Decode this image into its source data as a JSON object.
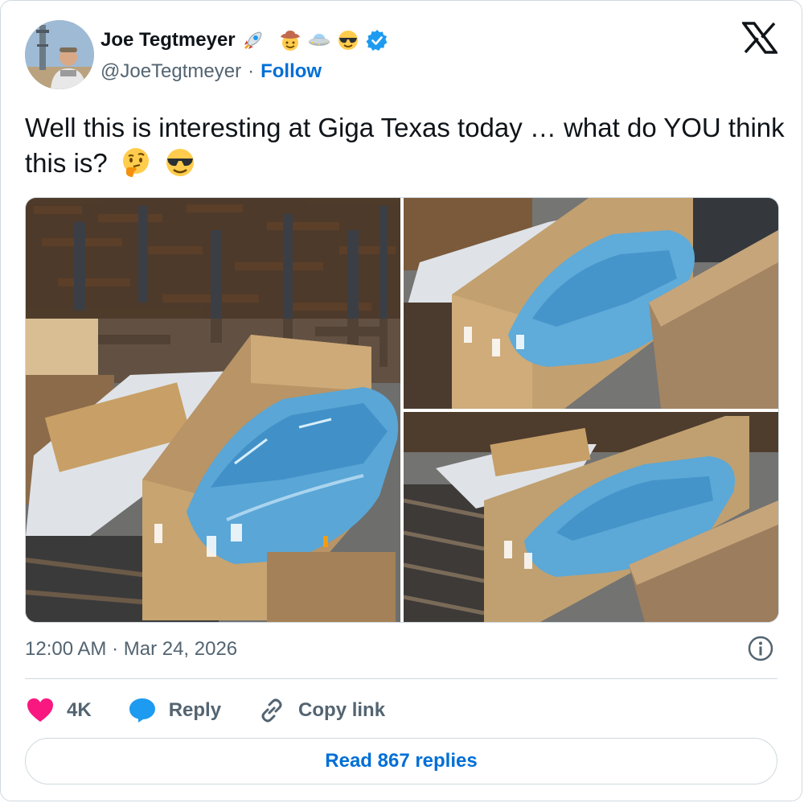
{
  "author": {
    "name": "Joe Tegtmeyer",
    "handle": "@JoeTegtmeyer",
    "separator": "·",
    "follow_label": "Follow",
    "name_emojis": [
      "rocket-emoji",
      "cowboy-emoji",
      "ufo-emoji",
      "sunglasses-emoji"
    ],
    "verified": true
  },
  "tweet": {
    "text": "Well this is interesting at Giga Texas today … what do YOU think this is?",
    "text_emojis": [
      "thinking-emoji",
      "sunglasses-emoji"
    ],
    "images": [
      {
        "name": "photo-main",
        "subject": "plastic-wrapped vehicle in open wooden crate"
      },
      {
        "name": "photo-top-right",
        "subject": "wrapped vehicle in crate, closer view"
      },
      {
        "name": "photo-bottom-right",
        "subject": "wrapped vehicle in crate, side view"
      }
    ]
  },
  "meta": {
    "timestamp": "12:00 AM · Mar 24, 2026"
  },
  "actions": {
    "like_count": "4K",
    "reply_label": "Reply",
    "copy_link_label": "Copy link"
  },
  "footer": {
    "read_replies_label": "Read 867 replies"
  },
  "colors": {
    "link": "#006fd6",
    "secondary_text": "#536471",
    "border": "#cfd9de",
    "like": "#f91880",
    "reply_bubble": "#1d9bf0",
    "verified": "#1d9bf0"
  }
}
